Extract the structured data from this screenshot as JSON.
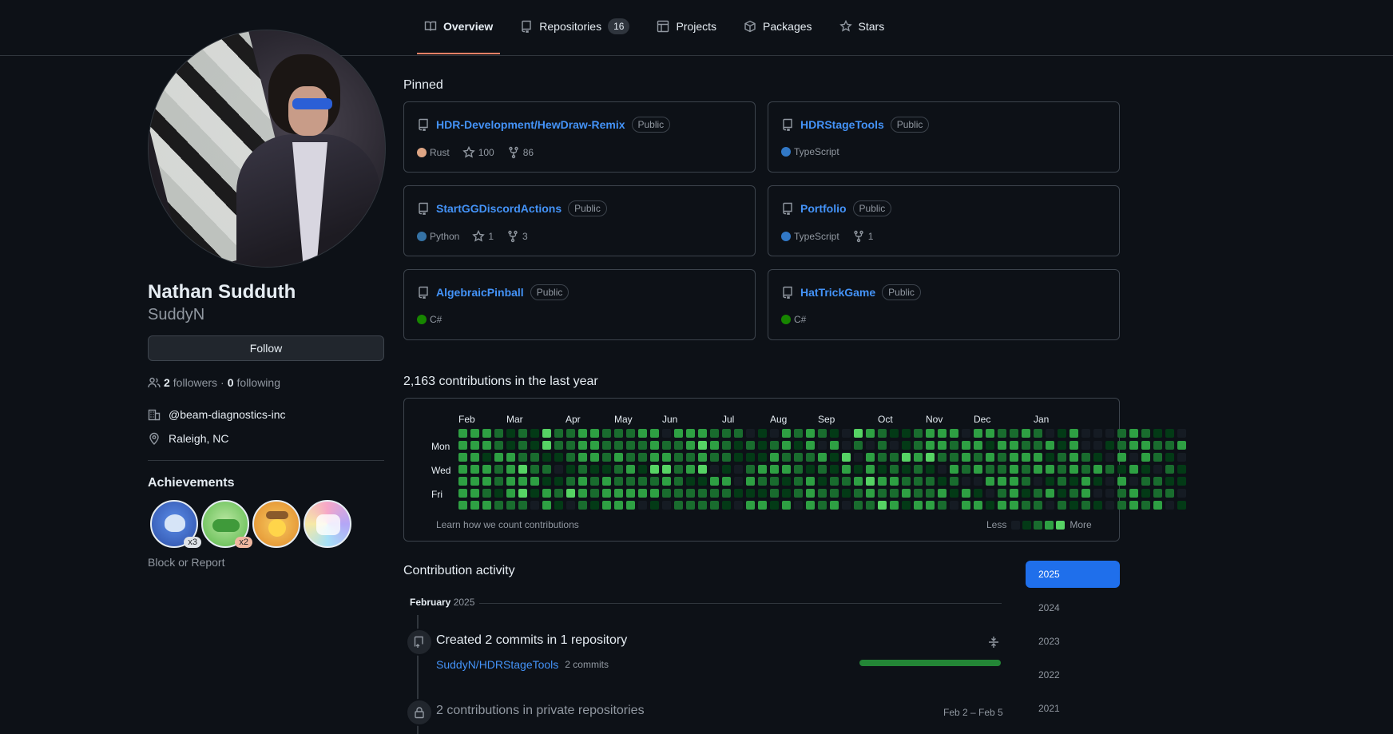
{
  "nav": {
    "tabs": [
      {
        "label": "Overview",
        "icon": "book-icon",
        "active": true
      },
      {
        "label": "Repositories",
        "icon": "repo-icon",
        "count": "16"
      },
      {
        "label": "Projects",
        "icon": "table-icon"
      },
      {
        "label": "Packages",
        "icon": "package-icon"
      },
      {
        "label": "Stars",
        "icon": "star-icon"
      }
    ]
  },
  "profile": {
    "full_name": "Nathan Sudduth",
    "username": "SuddyN",
    "follow_label": "Follow",
    "followers_count": "2",
    "followers_label": "followers",
    "separator": "·",
    "following_count": "0",
    "following_label": "following",
    "organization": "@beam-diagnostics-inc",
    "location": "Raleigh, NC",
    "achievements_title": "Achievements",
    "achievements": [
      {
        "name": "shark",
        "multiplier": "x3"
      },
      {
        "name": "pair-extraordinaire",
        "multiplier": "x2"
      },
      {
        "name": "quickdraw",
        "multiplier": ""
      },
      {
        "name": "yolo",
        "multiplier": ""
      }
    ],
    "block_report": "Block or Report"
  },
  "pinned": {
    "title": "Pinned",
    "items": [
      {
        "name": "HDR-Development/HewDraw-Remix",
        "visibility": "Public",
        "language": "Rust",
        "lang_color": "#dea584",
        "stars": "100",
        "forks": "86"
      },
      {
        "name": "HDRStageTools",
        "visibility": "Public",
        "language": "TypeScript",
        "lang_color": "#3178c6",
        "stars": "",
        "forks": ""
      },
      {
        "name": "StartGGDiscordActions",
        "visibility": "Public",
        "language": "Python",
        "lang_color": "#3572a5",
        "stars": "1",
        "forks": "3"
      },
      {
        "name": "Portfolio",
        "visibility": "Public",
        "language": "TypeScript",
        "lang_color": "#3178c6",
        "stars": "",
        "forks": "1"
      },
      {
        "name": "AlgebraicPinball",
        "visibility": "Public",
        "language": "C#",
        "lang_color": "#178600",
        "stars": "",
        "forks": ""
      },
      {
        "name": "HatTrickGame",
        "visibility": "Public",
        "language": "C#",
        "lang_color": "#178600",
        "stars": "",
        "forks": ""
      }
    ]
  },
  "contributions": {
    "headline": "2,163 contributions in the last year",
    "months": [
      "Feb",
      "Mar",
      "Apr",
      "May",
      "Jun",
      "Jul",
      "Aug",
      "Sep",
      "Oct",
      "Nov",
      "Dec",
      "Jan"
    ],
    "days": [
      "Mon",
      "Wed",
      "Fri"
    ],
    "learn_link": "Learn how we count contributions",
    "legend_less": "Less",
    "legend_more": "More",
    "level_colors": [
      "#151b23",
      "#033a16",
      "#196c2e",
      "#2ea043",
      "#56d364"
    ],
    "levels": [
      "3332121422332223303332220103232104321123330332232013000232110",
      "3332121422332222322343212123130302020123323313322313001233223",
      "3313322112332322332232211132223140322434223232333123210303210",
      "3332342201211231442340102333212131312121032322323323232131021",
      "3332333112323222232113303221231223433222120033320121310302211",
      "3321341324323333322222211121232212322322313102312312300231220",
      "3332220310213330102222103313032302243133203313322021210232301"
    ]
  },
  "activity": {
    "title": "Contribution activity",
    "month": "February",
    "year": "2025",
    "years": [
      "2025",
      "2024",
      "2023",
      "2022",
      "2021"
    ],
    "commits_text": "Created 2 commits in 1 repository",
    "repo": "SuddyN/HDRStageTools",
    "repo_commits": "2 commits",
    "commit_fraction": 1.0,
    "private_text": "2 contributions in private repositories",
    "private_dates": "Feb 2 – Feb 5"
  }
}
